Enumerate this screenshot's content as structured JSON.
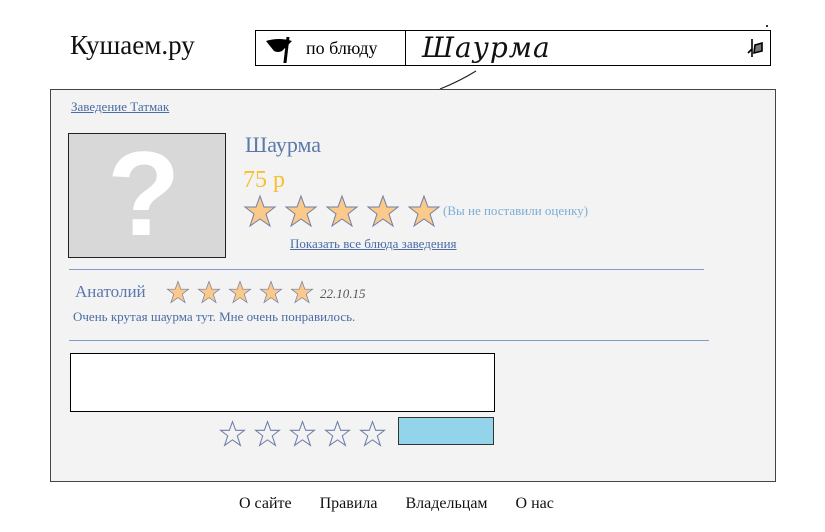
{
  "header": {
    "logo": "Кушаем.ру",
    "search": {
      "mode_label": "по блюду",
      "query": "Шаурма"
    }
  },
  "venue": {
    "link_label": "Заведение Татмак"
  },
  "dish": {
    "name": "Шаурма",
    "price": "75 р",
    "rating": 5,
    "rating_note": "(Вы не поставили оценку)",
    "all_dishes_link": "Показать все блюда заведения"
  },
  "review": {
    "author": "Анатолий",
    "rating": 5,
    "date": "22.10.15",
    "text": "Очень крутая шаурма тут. Мне очень понравилось."
  },
  "new_review": {
    "comment": "",
    "rating": 0
  },
  "footer": {
    "links": [
      "О сайте",
      "Правила",
      "Владельцам",
      "О нас"
    ]
  },
  "colors": {
    "star_fill": "#fbc98a",
    "star_stroke": "#6d7fa8",
    "accent_link": "#4a6ba5",
    "price": "#f5c131",
    "submit": "#94d4ea"
  }
}
